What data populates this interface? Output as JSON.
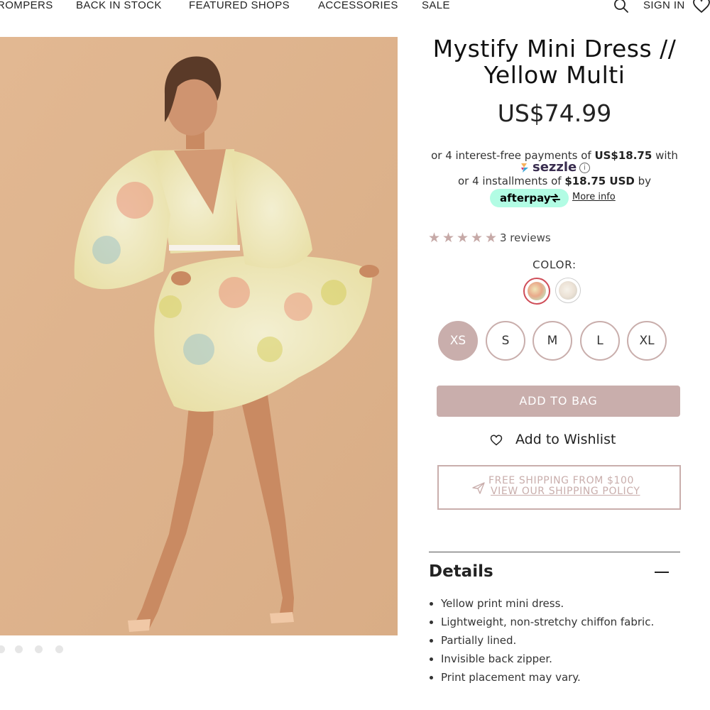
{
  "nav": {
    "items": [
      "ROMPERS",
      "BACK IN STOCK",
      "FEATURED SHOPS",
      "ACCESSORIES",
      "SALE"
    ],
    "sign_in": "SIGN IN",
    "icons": [
      "search-icon",
      "heart-icon"
    ]
  },
  "gallery": {
    "image": "woman-in-floral-mini-dress",
    "dot_count": 4
  },
  "product": {
    "title": "Mystify Mini Dress // Yellow Multi",
    "price": "US$74.99"
  },
  "payments": {
    "sezzle_prefix": "or 4 interest-free payments of ",
    "sezzle_amount": "US$18.75",
    "sezzle_suffix": " with",
    "sezzle_brand": "sezzle",
    "afterpay_prefix": "or 4 installments of ",
    "afterpay_amount": "$18.75 USD",
    "afterpay_suffix": " by",
    "afterpay_brand": "afterpay",
    "more_info": "More info"
  },
  "reviews": {
    "rating": 5,
    "label": "3 reviews"
  },
  "color": {
    "label": "COLOR:",
    "swatches": [
      "yellow-multi",
      "cream-multi"
    ],
    "selected": "yellow-multi"
  },
  "sizes": {
    "options": [
      "XS",
      "S",
      "M",
      "L",
      "XL"
    ],
    "selected": "XS"
  },
  "actions": {
    "add_to_bag": "ADD TO BAG",
    "wishlist": "Add to Wishlist"
  },
  "shipping": {
    "line1": "FREE SHIPPING FROM $100",
    "line2": "VIEW OUR SHIPPING POLICY"
  },
  "details": {
    "title": "Details",
    "items": [
      "Yellow print mini dress.",
      "Lightweight, non-stretchy chiffon fabric.",
      "Partially lined.",
      "Invisible back zipper.",
      "Print placement may vary."
    ]
  },
  "colors": {
    "accent": "#c9aeac",
    "star": "#c6a9a7",
    "swatch_selected": "#cf4d58",
    "afterpay_bg": "#b2fce4"
  }
}
